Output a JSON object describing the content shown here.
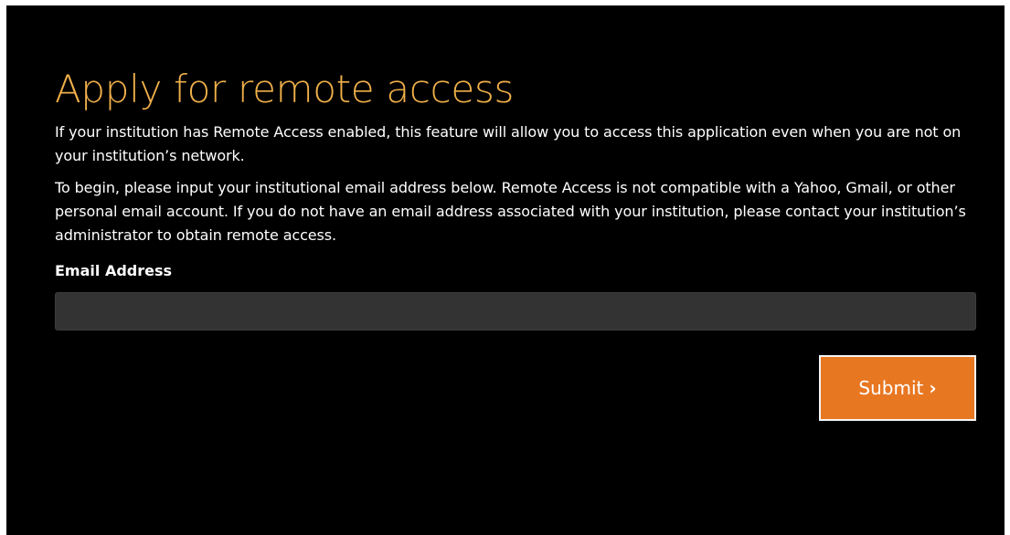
{
  "page": {
    "title": "Apply for remote access",
    "paragraph_1": "If your institution has Remote Access enabled, this feature will allow you to access this application even when you are not on your institution’s network.",
    "paragraph_2": "To begin, please input your institutional email address below. Remote Access is not compatible with a Yahoo, Gmail, or other personal email account. If you do not have an email address associated with your institution, please contact your institution’s administrator to obtain remote access."
  },
  "form": {
    "email_label": "Email Address",
    "email_value": "",
    "email_placeholder": ""
  },
  "actions": {
    "submit_label": "Submit",
    "submit_icon": "chevron-right-icon",
    "submit_glyph": "›"
  },
  "colors": {
    "background": "#000000",
    "title": "#f0b04a",
    "button": "#e87722",
    "input_bg": "#333333"
  }
}
